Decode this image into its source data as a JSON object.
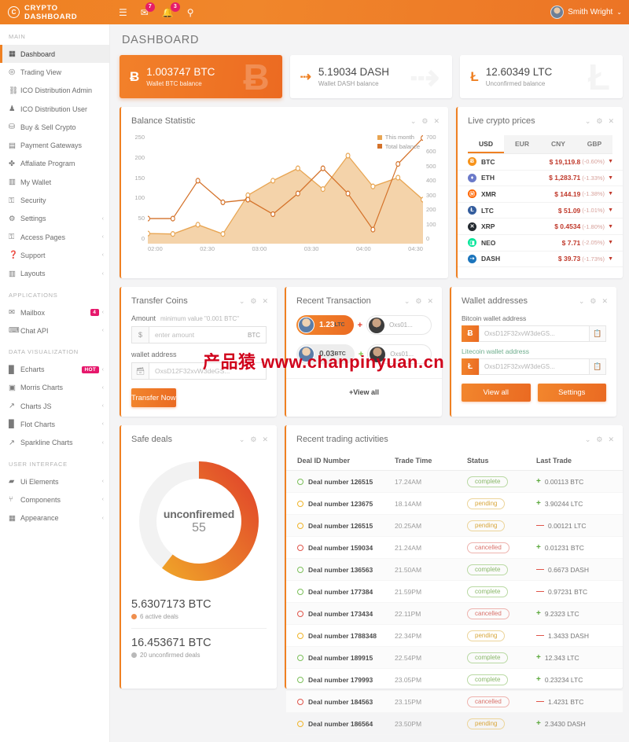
{
  "header": {
    "brand": "CRYPTO DASHBOARD",
    "logo_icon": "circle-c-logo-icon",
    "menu_icon": "menu-toggle-icon",
    "mail_icon": "mail-icon",
    "mail_badge": "7",
    "bell_icon": "bell-icon",
    "bell_badge": "3",
    "search_icon": "search-icon",
    "user_name": "Smith Wright",
    "caret": "⌄"
  },
  "sidebar": {
    "sections": [
      {
        "label": "MAIN",
        "items": [
          {
            "label": "Dashboard",
            "icon": "grid-icon",
            "active": true,
            "chevron": ""
          },
          {
            "label": "Trading View",
            "icon": "target-icon",
            "chevron": ""
          },
          {
            "label": "ICO Distribution Admin",
            "icon": "sitemap-icon",
            "chevron": ""
          },
          {
            "label": "ICO Distribution User",
            "icon": "user-icon",
            "chevron": ""
          },
          {
            "label": "Buy & Sell Crypto",
            "icon": "cart-icon",
            "chevron": ""
          },
          {
            "label": "Payment Gateways",
            "icon": "credit-card-icon",
            "chevron": ""
          },
          {
            "label": "Affaliate Program",
            "icon": "share-icon",
            "chevron": ""
          },
          {
            "label": "My Wallet",
            "icon": "wallet-icon",
            "chevron": ""
          },
          {
            "label": "Security",
            "icon": "lock-icon",
            "chevron": ""
          },
          {
            "label": "Settings",
            "icon": "gear-icon",
            "chevron": "‹"
          },
          {
            "label": "Access Pages",
            "icon": "lock-closed-icon",
            "chevron": "‹"
          },
          {
            "label": "Support",
            "icon": "question-icon",
            "chevron": "‹"
          },
          {
            "label": "Layouts",
            "icon": "columns-icon",
            "chevron": "‹"
          }
        ]
      },
      {
        "label": "APPLICATIONS",
        "items": [
          {
            "label": "Mailbox",
            "icon": "envelope-icon",
            "badge": "4",
            "chevron": "‹"
          },
          {
            "label": "Chat API",
            "icon": "chat-icon",
            "chevron": "‹"
          }
        ]
      },
      {
        "label": "DATA VISUALIZATION",
        "items": [
          {
            "label": "Echarts",
            "icon": "bar-chart-icon",
            "badge": "HOT",
            "chevron": "‹"
          },
          {
            "label": "Morris Charts",
            "icon": "chart-icon",
            "chevron": "‹"
          },
          {
            "label": "Charts JS",
            "icon": "line-chart-icon",
            "chevron": "‹"
          },
          {
            "label": "Flot Charts",
            "icon": "bar-chart-icon",
            "chevron": "‹"
          },
          {
            "label": "Sparkline Charts",
            "icon": "spark-icon",
            "chevron": "‹"
          }
        ]
      },
      {
        "label": "USER INTERFACE",
        "items": [
          {
            "label": "Ui Elements",
            "icon": "folder-icon",
            "chevron": "‹"
          },
          {
            "label": "Components",
            "icon": "puzzle-icon",
            "chevron": "‹"
          },
          {
            "label": "Appearance",
            "icon": "grid-icon",
            "chevron": "‹"
          }
        ]
      }
    ]
  },
  "page": {
    "title": "DASHBOARD"
  },
  "stats": [
    {
      "symbol": "Ƀ",
      "icon": "bitcoin-icon",
      "value": "1.003747 BTC",
      "sub": "Wallet BTC balance",
      "primary": true
    },
    {
      "symbol": "⇢",
      "icon": "dash-icon",
      "value": "5.19034 DASH",
      "sub": "Wallet DASH balance",
      "primary": false
    },
    {
      "symbol": "Ł",
      "icon": "litecoin-icon",
      "value": "12.60349 LTC",
      "sub": "Unconfirmed balance",
      "primary": false
    }
  ],
  "card_tools": {
    "collapse": "⌄",
    "settings": "⚙",
    "close": "✕"
  },
  "balance_card": {
    "title": "Balance Statistic"
  },
  "chart_data": {
    "type": "area",
    "title": "Balance Statistic",
    "xlabel": "",
    "ylabel": "",
    "grid": false,
    "legend_position": "top-right",
    "x": [
      "01:55",
      "02:10",
      "02:25",
      "02:40",
      "02:55",
      "03:10",
      "03:25",
      "03:40",
      "03:55",
      "04:10",
      "04:25",
      "04:40",
      "04:55"
    ],
    "xticks": [
      "02:00",
      "02:30",
      "03:00",
      "03:30",
      "04:00",
      "04:30"
    ],
    "ylim": [
      0,
      250
    ],
    "yticks": [
      0,
      50,
      100,
      150,
      200,
      250
    ],
    "y2lim": [
      0,
      700
    ],
    "y2ticks": [
      0,
      100,
      200,
      300,
      400,
      500,
      600,
      700
    ],
    "series": [
      {
        "name": "This month",
        "axis": "left",
        "color": "#e8a552",
        "fill": "#f2cb9b",
        "values": [
          23,
          22,
          43,
          22,
          110,
          143,
          171,
          124,
          200,
          130,
          150,
          100
        ]
      },
      {
        "name": "Total balance",
        "axis": "left",
        "color": "#d4722a",
        "values": [
          57,
          57,
          143,
          94,
          100,
          67,
          114,
          171,
          114,
          32,
          181,
          240
        ]
      }
    ]
  },
  "prices_card": {
    "title": "Live crypto prices",
    "currencies": [
      "USD",
      "EUR",
      "CNY",
      "GBP"
    ],
    "active_currency": "USD",
    "arrow": "▼",
    "rows": [
      {
        "coin": "BTC",
        "icon": "bitcoin-coin-icon",
        "color": "#f7931a",
        "glyph": "Ƀ",
        "price": "$ 19,119.8",
        "change": "(-0.60%)"
      },
      {
        "coin": "ETH",
        "icon": "ethereum-coin-icon",
        "color": "#6b7ac9",
        "glyph": "♦",
        "price": "$ 1,283.71",
        "change": "(-1.33%)"
      },
      {
        "coin": "XMR",
        "icon": "monero-coin-icon",
        "color": "#ff6600",
        "glyph": "Ⓜ",
        "price": "$ 144.19",
        "change": "(-1.38%)"
      },
      {
        "coin": "LTC",
        "icon": "litecoin-coin-icon",
        "color": "#345d9d",
        "glyph": "Ł",
        "price": "$ 51.09",
        "change": "(-1.01%)"
      },
      {
        "coin": "XRP",
        "icon": "ripple-coin-icon",
        "color": "#23292f",
        "glyph": "✕",
        "price": "$ 0.4534",
        "change": "(-1.80%)"
      },
      {
        "coin": "NEO",
        "icon": "neo-coin-icon",
        "color": "#00e599",
        "glyph": "◨",
        "price": "$ 7.71",
        "change": "(-2.05%)"
      },
      {
        "coin": "DASH",
        "icon": "dash-coin-icon",
        "color": "#1c75bc",
        "glyph": "⇢",
        "price": "$ 39.73",
        "change": "(-1.73%)"
      }
    ]
  },
  "transfer": {
    "title": "Transfer Coins",
    "amount_label": "Amount",
    "amount_hint": "minimum value \"0.001 BTC\"",
    "currency_addon": "$",
    "amount_placeholder": "enter amount",
    "amount_suffix": "BTC",
    "wallet_label": "wallet address",
    "wallet_icon": "wallet-icon",
    "wallet_placeholder": "OxsD12F32xvW3deGS...",
    "button": "Transfer Now"
  },
  "recent": {
    "title": "Recent Transaction",
    "view_all": "+View all",
    "rows": [
      {
        "amount": "1.23",
        "unit": "LTC",
        "sign": "+",
        "sign_color": "#e0382b",
        "to": "Oxs01...",
        "hot": true
      },
      {
        "amount": "0.03",
        "unit": "BTC",
        "sign": "+",
        "sign_color": "#7bc144",
        "to": "Oxs01...",
        "hot": false
      }
    ]
  },
  "wallet": {
    "title": "Wallet addresses",
    "btc_label": "Bitcoin wallet address",
    "btc_glyph": "Ƀ",
    "btc_value": "OxsD12F32xvW3deGS...",
    "ltc_label": "Litecoin wallet address",
    "ltc_glyph": "Ł",
    "ltc_value": "OxsD12F32xvW3deGS...",
    "copy_icon": "copy-icon",
    "view_all": "View all",
    "settings": "Settings"
  },
  "safe_deals": {
    "title": "Safe deals",
    "donut_label": "unconfiremed",
    "donut_value": "55",
    "active_amount": "5.6307173 BTC",
    "active_sub": "6 active deals",
    "unconfirmed_amount": "16.453671 BTC",
    "unconfirmed_sub": "20 unconfirmed deals"
  },
  "trading": {
    "title": "Recent trading activities",
    "columns": [
      "Deal ID Number",
      "Trade Time",
      "Status",
      "Last Trade"
    ],
    "rows": [
      {
        "deal": "Deal number 126515",
        "time": "17.24AM",
        "status": "complete",
        "dot": "#7cc05a",
        "sign": "+",
        "sign_color": "#5aa83a",
        "trade": "0.00113 BTC"
      },
      {
        "deal": "Deal number 123675",
        "time": "18.14AM",
        "status": "pending",
        "dot": "#f0b429",
        "sign": "+",
        "sign_color": "#5aa83a",
        "trade": "3.90244 LTC"
      },
      {
        "deal": "Deal number 126515",
        "time": "20.25AM",
        "status": "pending",
        "dot": "#f0b429",
        "sign": "—",
        "sign_color": "#e0554a",
        "trade": "0.00121 LTC"
      },
      {
        "deal": "Deal number 159034",
        "time": "21.24AM",
        "status": "cancelled",
        "dot": "#e0554a",
        "sign": "+",
        "sign_color": "#5aa83a",
        "trade": "0.01231 BTC"
      },
      {
        "deal": "Deal number 136563",
        "time": "21.50AM",
        "status": "complete",
        "dot": "#7cc05a",
        "sign": "—",
        "sign_color": "#e0554a",
        "trade": "0.6673 DASH"
      },
      {
        "deal": "Deal number 177384",
        "time": "21.59PM",
        "status": "complete",
        "dot": "#7cc05a",
        "sign": "—",
        "sign_color": "#e0554a",
        "trade": "0.97231 BTC"
      },
      {
        "deal": "Deal number 173434",
        "time": "22.11PM",
        "status": "cancelled",
        "dot": "#e0554a",
        "sign": "+",
        "sign_color": "#5aa83a",
        "trade": "9.2323 LTC"
      },
      {
        "deal": "Deal number 1788348",
        "time": "22.34PM",
        "status": "pending",
        "dot": "#f0b429",
        "sign": "—",
        "sign_color": "#e0554a",
        "trade": "1.3433 DASH"
      },
      {
        "deal": "Deal number 189915",
        "time": "22.54PM",
        "status": "complete",
        "dot": "#7cc05a",
        "sign": "+",
        "sign_color": "#5aa83a",
        "trade": "12.343 LTC"
      },
      {
        "deal": "Deal number 179993",
        "time": "23.05PM",
        "status": "complete",
        "dot": "#7cc05a",
        "sign": "+",
        "sign_color": "#5aa83a",
        "trade": "0.23234 LTC"
      },
      {
        "deal": "Deal number 184563",
        "time": "23.15PM",
        "status": "cancelled",
        "dot": "#e0554a",
        "sign": "—",
        "sign_color": "#e0554a",
        "trade": "1.4231 BTC"
      },
      {
        "deal": "Deal number 186564",
        "time": "23.50PM",
        "status": "pending",
        "dot": "#f0b429",
        "sign": "+",
        "sign_color": "#5aa83a",
        "trade": "2.3430 DASH"
      }
    ]
  },
  "watermark": {
    "cn_text": "产品猿",
    "url_text": "www.chanpinyuan.cn"
  }
}
